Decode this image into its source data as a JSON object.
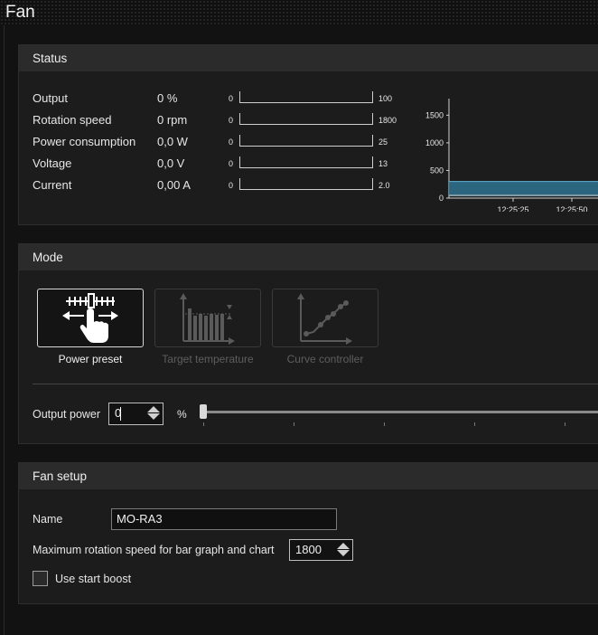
{
  "window": {
    "title": "Fan"
  },
  "status": {
    "header": "Status",
    "rows": [
      {
        "label": "Output",
        "value": "0 %",
        "min": "0",
        "max": "100",
        "fill": 0
      },
      {
        "label": "Rotation speed",
        "value": "0 rpm",
        "min": "0",
        "max": "1800",
        "fill": 0
      },
      {
        "label": "Power consumption",
        "value": "0,0 W",
        "min": "0",
        "max": "25",
        "fill": 0
      },
      {
        "label": "Voltage",
        "value": "0,0 V",
        "min": "0",
        "max": "13",
        "fill": 0
      },
      {
        "label": "Current",
        "value": "0,00 A",
        "min": "0",
        "max": "2.0",
        "fill": 0
      }
    ]
  },
  "chart_data": {
    "type": "area",
    "x": [
      "12:25:25",
      "12:25:50"
    ],
    "yticks": [
      "1500",
      "1000",
      "500",
      "0"
    ],
    "ylim": [
      0,
      1800
    ],
    "series": [
      {
        "values": [
          300,
          300,
          300
        ]
      }
    ],
    "colors": {
      "area": "#2f6f8a",
      "line": "#5fb4d8"
    }
  },
  "mode": {
    "header": "Mode",
    "options": [
      {
        "label": "Power preset",
        "icon": "power-preset-icon",
        "active": true
      },
      {
        "label": "Target temperature",
        "icon": "target-temperature-icon",
        "active": false
      },
      {
        "label": "Curve controller",
        "icon": "curve-controller-icon",
        "active": false
      }
    ],
    "output_power_label": "Output power",
    "output_power_value": "0",
    "unit": "%",
    "slider_value": 0
  },
  "fan_setup": {
    "header": "Fan setup",
    "name_label": "Name",
    "name_value": "MO-RA3",
    "max_speed_label": "Maximum rotation speed for bar graph and chart",
    "max_speed_value": "1800",
    "start_boost_label": "Use start boost",
    "start_boost_checked": false
  }
}
